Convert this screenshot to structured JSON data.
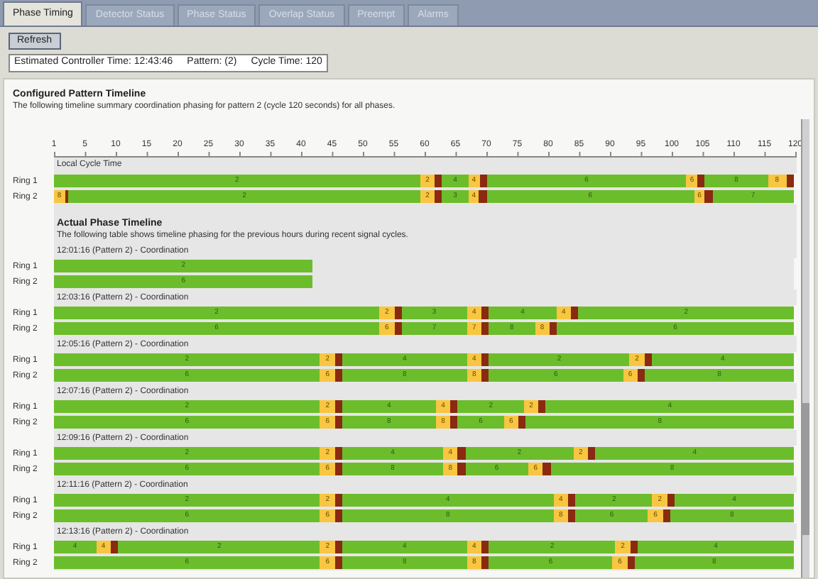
{
  "tabs": [
    {
      "label": "Phase Timing",
      "selected": true
    },
    {
      "label": "Detector Status",
      "selected": false
    },
    {
      "label": "Phase Status",
      "selected": false
    },
    {
      "label": "Overlap Status",
      "selected": false
    },
    {
      "label": "Preempt",
      "selected": false
    },
    {
      "label": "Alarms",
      "selected": false
    }
  ],
  "refresh_button": "Refresh",
  "status_items": [
    "Estimated Controller Time: 12:43:46",
    "Pattern: (2)",
    "Cycle Time: 120"
  ],
  "configured": {
    "title": "Configured Pattern Timeline",
    "description": "The following timeline summary coordination phasing for pattern 2 (cycle 120 seconds) for all phases.",
    "axis_ticks": [
      "1",
      "5",
      "10",
      "15",
      "20",
      "25",
      "30",
      "35",
      "40",
      "45",
      "50",
      "55",
      "60",
      "65",
      "70",
      "75",
      "80",
      "85",
      "90",
      "95",
      "100",
      "105",
      "110",
      "115",
      "120"
    ],
    "caption": "Local Cycle Time",
    "rings": [
      {
        "label": "Ring 1",
        "segments": [
          {
            "kind": "green",
            "label": "2"
          },
          {
            "kind": "yellow",
            "label": "2"
          },
          {
            "kind": "red"
          },
          {
            "kind": "green",
            "label": "4"
          },
          {
            "kind": "yellow",
            "label": "4"
          },
          {
            "kind": "red"
          },
          {
            "kind": "green",
            "label": "6"
          },
          {
            "kind": "yellow",
            "label": "6"
          },
          {
            "kind": "red"
          },
          {
            "kind": "green",
            "label": "8"
          },
          {
            "kind": "yellow",
            "label": "8"
          },
          {
            "kind": "red"
          }
        ]
      },
      {
        "label": "Ring 2",
        "segments": [
          {
            "kind": "yellow",
            "label": "8"
          },
          {
            "kind": "red"
          },
          {
            "kind": "green",
            "label": "2"
          },
          {
            "kind": "yellow",
            "label": "2"
          },
          {
            "kind": "red"
          },
          {
            "kind": "green",
            "label": "3"
          },
          {
            "kind": "yellow",
            "label": "4"
          },
          {
            "kind": "red"
          },
          {
            "kind": "green",
            "label": "6"
          },
          {
            "kind": "yellow",
            "label": "6"
          },
          {
            "kind": "red"
          },
          {
            "kind": "green",
            "label": "7"
          }
        ]
      }
    ]
  },
  "actual": {
    "title": "Actual Phase Timeline",
    "description": "The following table shows timeline phasing for the previous hours during recent signal cycles.",
    "blocks": [
      {
        "header": "12:01:16 (Pattern 2) - Coordination",
        "rings": [
          {
            "label": "Ring 1",
            "segments": [
              {
                "kind": "green",
                "label": "2"
              }
            ]
          },
          {
            "label": "Ring 2",
            "segments": [
              {
                "kind": "green",
                "label": "6"
              }
            ]
          }
        ]
      },
      {
        "header": "12:03:16 (Pattern 2) - Coordination",
        "rings": [
          {
            "label": "Ring 1",
            "segments": [
              {
                "kind": "green",
                "label": "2"
              },
              {
                "kind": "yellow",
                "label": "2"
              },
              {
                "kind": "red"
              },
              {
                "kind": "green",
                "label": "3"
              },
              {
                "kind": "yellow",
                "label": "4"
              },
              {
                "kind": "red"
              },
              {
                "kind": "green",
                "label": "4"
              },
              {
                "kind": "yellow",
                "label": "4"
              },
              {
                "kind": "red"
              },
              {
                "kind": "green",
                "label": "2"
              }
            ]
          },
          {
            "label": "Ring 2",
            "segments": [
              {
                "kind": "green",
                "label": "6"
              },
              {
                "kind": "yellow",
                "label": "6"
              },
              {
                "kind": "red"
              },
              {
                "kind": "green",
                "label": "7"
              },
              {
                "kind": "yellow",
                "label": "7"
              },
              {
                "kind": "red"
              },
              {
                "kind": "green",
                "label": "8"
              },
              {
                "kind": "yellow",
                "label": "8"
              },
              {
                "kind": "red"
              },
              {
                "kind": "green",
                "label": "6"
              }
            ]
          }
        ]
      },
      {
        "header": "12:05:16 (Pattern 2) - Coordination",
        "rings": [
          {
            "label": "Ring 1",
            "segments": [
              {
                "kind": "green",
                "label": "2"
              },
              {
                "kind": "yellow",
                "label": "2"
              },
              {
                "kind": "red"
              },
              {
                "kind": "green",
                "label": "4"
              },
              {
                "kind": "yellow",
                "label": "4"
              },
              {
                "kind": "red"
              },
              {
                "kind": "green",
                "label": "2"
              },
              {
                "kind": "yellow",
                "label": "2"
              },
              {
                "kind": "red"
              },
              {
                "kind": "green",
                "label": "4"
              }
            ]
          },
          {
            "label": "Ring 2",
            "segments": [
              {
                "kind": "green",
                "label": "6"
              },
              {
                "kind": "yellow",
                "label": "6"
              },
              {
                "kind": "red"
              },
              {
                "kind": "green",
                "label": "8"
              },
              {
                "kind": "yellow",
                "label": "8"
              },
              {
                "kind": "red"
              },
              {
                "kind": "green",
                "label": "6"
              },
              {
                "kind": "yellow",
                "label": "6"
              },
              {
                "kind": "red"
              },
              {
                "kind": "green",
                "label": "8"
              }
            ]
          }
        ]
      },
      {
        "header": "12:07:16 (Pattern 2) - Coordination",
        "rings": [
          {
            "label": "Ring 1",
            "segments": [
              {
                "kind": "green",
                "label": "2"
              },
              {
                "kind": "yellow",
                "label": "2"
              },
              {
                "kind": "red"
              },
              {
                "kind": "green",
                "label": "4"
              },
              {
                "kind": "yellow",
                "label": "4"
              },
              {
                "kind": "red"
              },
              {
                "kind": "green",
                "label": "2"
              },
              {
                "kind": "yellow",
                "label": "2"
              },
              {
                "kind": "red"
              },
              {
                "kind": "green",
                "label": "4"
              }
            ]
          },
          {
            "label": "Ring 2",
            "segments": [
              {
                "kind": "green",
                "label": "6"
              },
              {
                "kind": "yellow",
                "label": "6"
              },
              {
                "kind": "red"
              },
              {
                "kind": "green",
                "label": "8"
              },
              {
                "kind": "yellow",
                "label": "8"
              },
              {
                "kind": "red"
              },
              {
                "kind": "green",
                "label": "6"
              },
              {
                "kind": "yellow",
                "label": "6"
              },
              {
                "kind": "red"
              },
              {
                "kind": "green",
                "label": "8"
              }
            ]
          }
        ]
      },
      {
        "header": "12:09:16 (Pattern 2) - Coordination",
        "rings": [
          {
            "label": "Ring 1",
            "segments": [
              {
                "kind": "green",
                "label": "2"
              },
              {
                "kind": "yellow",
                "label": "2"
              },
              {
                "kind": "red"
              },
              {
                "kind": "green",
                "label": "4"
              },
              {
                "kind": "yellow",
                "label": "4"
              },
              {
                "kind": "red"
              },
              {
                "kind": "green",
                "label": "2"
              },
              {
                "kind": "yellow",
                "label": "2"
              },
              {
                "kind": "red"
              },
              {
                "kind": "green",
                "label": "4"
              }
            ]
          },
          {
            "label": "Ring 2",
            "segments": [
              {
                "kind": "green",
                "label": "6"
              },
              {
                "kind": "yellow",
                "label": "6"
              },
              {
                "kind": "red"
              },
              {
                "kind": "green",
                "label": "8"
              },
              {
                "kind": "yellow",
                "label": "8"
              },
              {
                "kind": "red"
              },
              {
                "kind": "green",
                "label": "6"
              },
              {
                "kind": "yellow",
                "label": "6"
              },
              {
                "kind": "red"
              },
              {
                "kind": "green",
                "label": "8"
              }
            ]
          }
        ]
      },
      {
        "header": "12:11:16 (Pattern 2) - Coordination",
        "rings": [
          {
            "label": "Ring 1",
            "segments": [
              {
                "kind": "green",
                "label": "2"
              },
              {
                "kind": "yellow",
                "label": "2"
              },
              {
                "kind": "red"
              },
              {
                "kind": "green",
                "label": "4"
              },
              {
                "kind": "yellow",
                "label": "4"
              },
              {
                "kind": "red"
              },
              {
                "kind": "green",
                "label": "2"
              },
              {
                "kind": "yellow",
                "label": "2"
              },
              {
                "kind": "red"
              },
              {
                "kind": "green",
                "label": "4"
              }
            ]
          },
          {
            "label": "Ring 2",
            "segments": [
              {
                "kind": "green",
                "label": "6"
              },
              {
                "kind": "yellow",
                "label": "6"
              },
              {
                "kind": "red"
              },
              {
                "kind": "green",
                "label": "8"
              },
              {
                "kind": "yellow",
                "label": "8"
              },
              {
                "kind": "red"
              },
              {
                "kind": "green",
                "label": "6"
              },
              {
                "kind": "yellow",
                "label": "6"
              },
              {
                "kind": "red"
              },
              {
                "kind": "green",
                "label": "8"
              }
            ]
          }
        ]
      },
      {
        "header": "12:13:16 (Pattern 2) - Coordination",
        "rings": [
          {
            "label": "Ring 1",
            "segments": [
              {
                "kind": "green",
                "label": "4"
              },
              {
                "kind": "yellow",
                "label": "4"
              },
              {
                "kind": "red"
              },
              {
                "kind": "green",
                "label": "2"
              },
              {
                "kind": "yellow",
                "label": "2"
              },
              {
                "kind": "red"
              },
              {
                "kind": "green",
                "label": "4"
              },
              {
                "kind": "yellow",
                "label": "4"
              },
              {
                "kind": "red"
              },
              {
                "kind": "green",
                "label": "2"
              },
              {
                "kind": "yellow",
                "label": "2"
              },
              {
                "kind": "red"
              },
              {
                "kind": "green",
                "label": "4"
              }
            ]
          },
          {
            "label": "Ring 2",
            "segments": [
              {
                "kind": "green",
                "label": "6"
              },
              {
                "kind": "yellow",
                "label": "6"
              },
              {
                "kind": "red"
              },
              {
                "kind": "green",
                "label": "8"
              },
              {
                "kind": "yellow",
                "label": "8"
              },
              {
                "kind": "red"
              },
              {
                "kind": "green",
                "label": "6"
              },
              {
                "kind": "yellow",
                "label": "6"
              },
              {
                "kind": "red"
              },
              {
                "kind": "green",
                "label": "8"
              }
            ]
          }
        ]
      }
    ]
  }
}
